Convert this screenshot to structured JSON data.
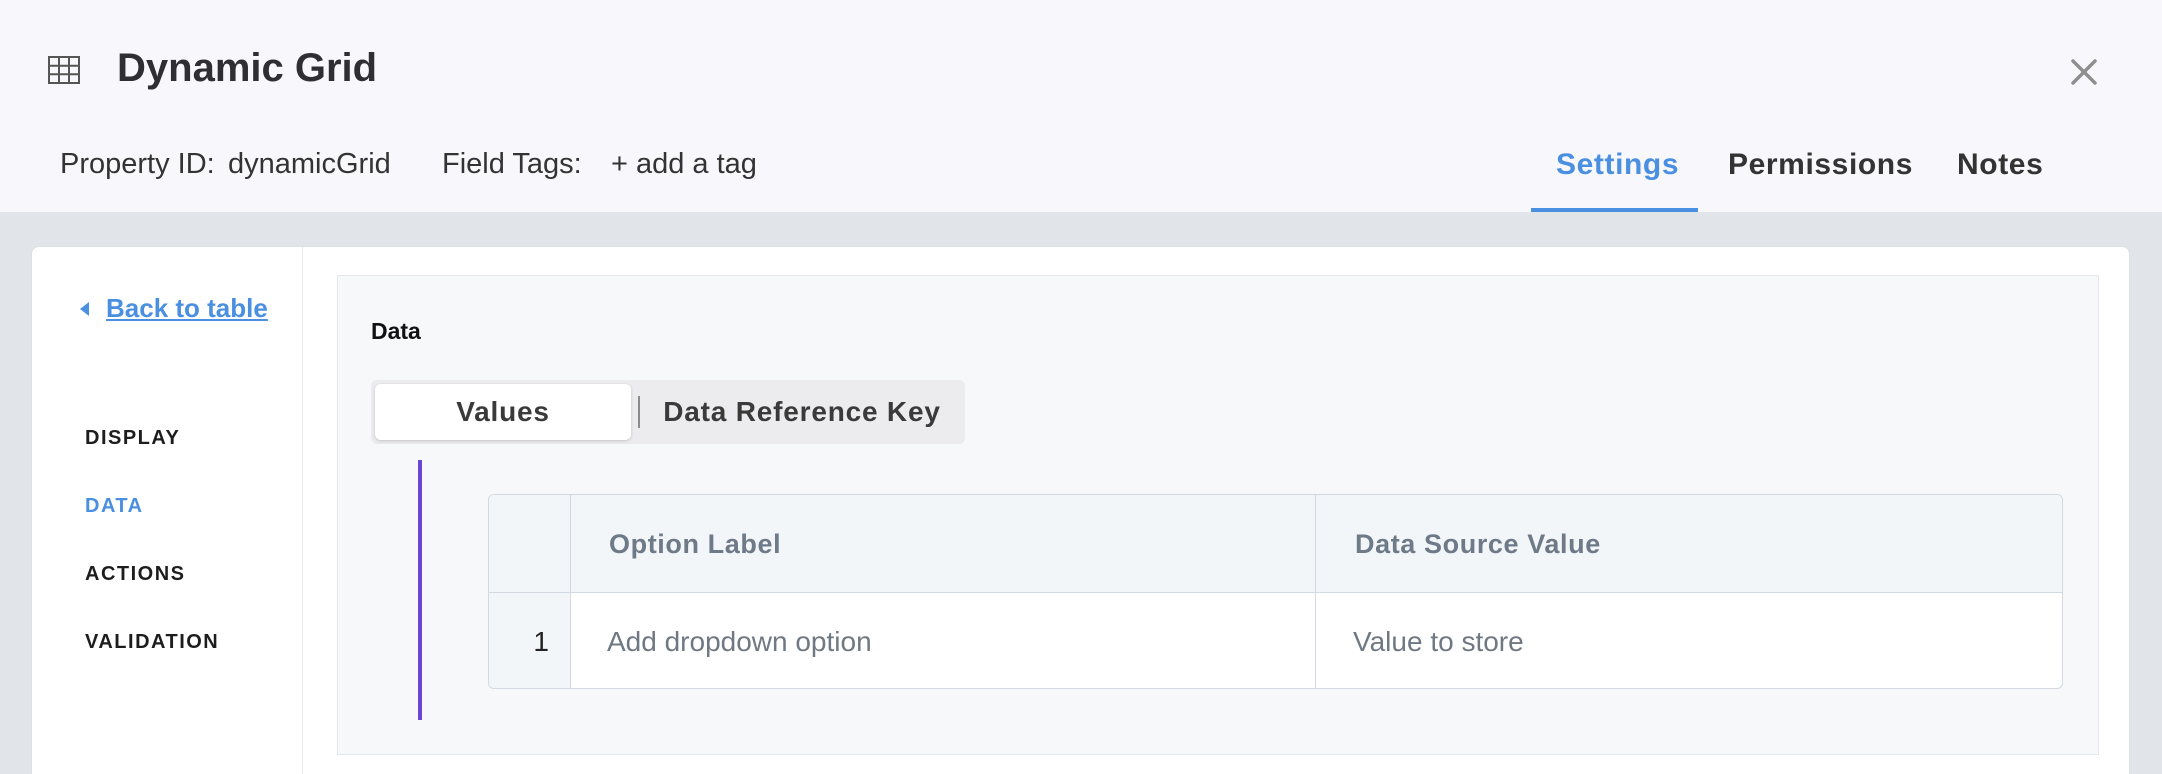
{
  "header": {
    "title": "Dynamic Grid",
    "property_id_label": "Property ID:",
    "property_id_value": "dynamicGrid",
    "field_tags_label": "Field Tags:",
    "add_tag_label": "+ add a tag",
    "tabs": [
      {
        "label": "Settings",
        "active": true
      },
      {
        "label": "Permissions",
        "active": false
      },
      {
        "label": "Notes",
        "active": false
      }
    ]
  },
  "sidebar": {
    "back_label": "Back to table",
    "items": [
      {
        "label": "DISPLAY",
        "active": false
      },
      {
        "label": "DATA",
        "active": true
      },
      {
        "label": "ACTIONS",
        "active": false
      },
      {
        "label": "VALIDATION",
        "active": false
      }
    ]
  },
  "main": {
    "section_label": "Data",
    "segments": [
      {
        "label": "Values",
        "active": true
      },
      {
        "label": "Data Reference Key",
        "active": false
      }
    ],
    "table": {
      "columns": [
        "Option Label",
        "Data Source Value"
      ],
      "rows": [
        {
          "index": "1",
          "label_placeholder": "Add dropdown option",
          "value_placeholder": "Value to store"
        }
      ]
    }
  },
  "icons": {
    "title_icon": "grid-table-icon",
    "close_icon": "close-icon",
    "back_icon": "caret-left-icon"
  },
  "colors": {
    "accent": "#4a8fe0",
    "purple_bar": "#6a46d6",
    "header_bg": "#f8f8fc",
    "page_bg": "#e1e5e9"
  }
}
